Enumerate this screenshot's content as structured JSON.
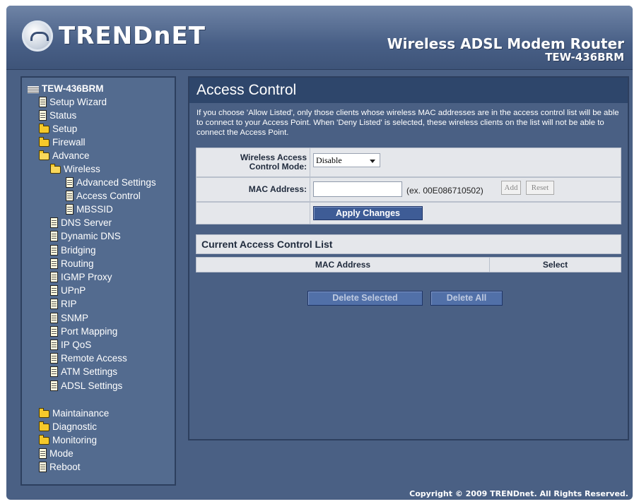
{
  "header": {
    "logo_text": "TRENDnET",
    "product_title": "Wireless ADSL Modem Router",
    "product_model": "TEW-436BRM"
  },
  "sidebar": {
    "root": "TEW-436BRM",
    "items": [
      {
        "label": "Setup Wizard",
        "icon": "page-icon"
      },
      {
        "label": "Status",
        "icon": "page-icon"
      },
      {
        "label": "Setup",
        "icon": "folder-icon"
      },
      {
        "label": "Firewall",
        "icon": "folder-icon"
      },
      {
        "label": "Advance",
        "icon": "folder-open-icon"
      },
      {
        "label": "Wireless",
        "icon": "folder-open-icon"
      },
      {
        "label": "Advanced Settings",
        "icon": "page-icon"
      },
      {
        "label": "Access Control",
        "icon": "page-icon"
      },
      {
        "label": "MBSSID",
        "icon": "page-icon"
      },
      {
        "label": "DNS Server",
        "icon": "page-icon"
      },
      {
        "label": "Dynamic DNS",
        "icon": "page-icon"
      },
      {
        "label": "Bridging",
        "icon": "page-icon"
      },
      {
        "label": "Routing",
        "icon": "page-icon"
      },
      {
        "label": "IGMP Proxy",
        "icon": "page-icon"
      },
      {
        "label": "UPnP",
        "icon": "page-icon"
      },
      {
        "label": "RIP",
        "icon": "page-icon"
      },
      {
        "label": "SNMP",
        "icon": "page-icon"
      },
      {
        "label": "Port Mapping",
        "icon": "page-icon"
      },
      {
        "label": "IP QoS",
        "icon": "page-icon"
      },
      {
        "label": "Remote Access",
        "icon": "page-icon"
      },
      {
        "label": "ATM Settings",
        "icon": "page-icon"
      },
      {
        "label": "ADSL Settings",
        "icon": "page-icon"
      },
      {
        "label": "Maintainance",
        "icon": "folder-icon"
      },
      {
        "label": "Diagnostic",
        "icon": "folder-icon"
      },
      {
        "label": "Monitoring",
        "icon": "folder-icon"
      },
      {
        "label": "Mode",
        "icon": "page-icon"
      },
      {
        "label": "Reboot",
        "icon": "page-icon"
      }
    ]
  },
  "main": {
    "title": "Access Control",
    "description": "If you choose 'Allow Listed', only those clients whose wireless MAC addresses are in the access control list will be able to connect to your Access Point. When 'Deny Listed' is selected, these wireless clients on the list will not be able to connect the Access Point.",
    "mode_label": "Wireless Access Control Mode:",
    "mode_value": "Disable",
    "mac_label": "MAC Address:",
    "mac_value": "",
    "mac_hint": "(ex. 00E086710502)",
    "add_label": "Add",
    "reset_label": "Reset",
    "apply_label": "Apply Changes",
    "list_title": "Current Access Control List",
    "col_mac": "MAC Address",
    "col_select": "Select",
    "delete_selected_label": "Delete Selected",
    "delete_all_label": "Delete All"
  },
  "footer": {
    "copyright": "Copyright © 2009 TRENDnet. All Rights Reserved."
  }
}
